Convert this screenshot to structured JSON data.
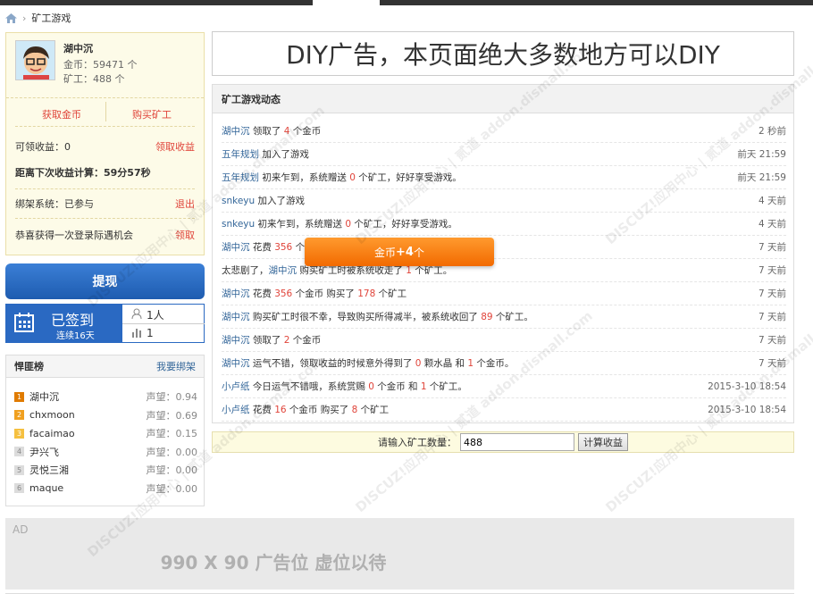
{
  "breadcrumb": {
    "current": "矿工游戏"
  },
  "user": {
    "name": "湖中沉",
    "gold": "金币：59471 个",
    "miners": "矿工：488 个",
    "get_gold": "获取金币",
    "buy_miner": "购买矿工",
    "claimable_label": "可领收益：0",
    "claim_btn": "领取收益",
    "countdown": "距离下次收益计算：59分57秒",
    "gang_label": "绑架系统：已参与",
    "gang_exit": "退出",
    "lottery_label": "恭喜获得一次登录际遇机会",
    "lottery_btn": "领取"
  },
  "withdraw": "提现",
  "signin": {
    "status": "已签到",
    "streak": "连续16天",
    "people": "1人",
    "rank": "1"
  },
  "ranking": {
    "title": "悍匪榜",
    "link": "我要绑架",
    "rows": [
      {
        "rank": "1",
        "name": "湖中沉",
        "rep": "声望：0.94",
        "color": "#e07b00"
      },
      {
        "rank": "2",
        "name": "chxmoon",
        "rep": "声望：0.69",
        "color": "#f0a020"
      },
      {
        "rank": "3",
        "name": "facaimao",
        "rep": "声望：0.15",
        "color": "#f5c040"
      },
      {
        "rank": "4",
        "name": "尹兴飞",
        "rep": "声望：0.00",
        "color": "#dcdcdc"
      },
      {
        "rank": "5",
        "name": "灵悦三湘",
        "rep": "声望：0.00",
        "color": "#dcdcdc"
      },
      {
        "rank": "6",
        "name": "maque",
        "rep": "声望：0.00",
        "color": "#dcdcdc"
      }
    ]
  },
  "diy": "DIY广告，本页面绝大多数地方可以DIY",
  "feed": {
    "title": "矿工游戏动态",
    "items": [
      {
        "who": "湖中沉",
        "a": " 领取了 ",
        "n1": "4",
        "b": " 个金币",
        "n2": "",
        "c": "",
        "n3": "",
        "d": "",
        "time": "2 秒前"
      },
      {
        "who": "五年规划",
        "a": " 加入了游戏",
        "n1": "",
        "b": "",
        "n2": "",
        "c": "",
        "n3": "",
        "d": "",
        "time": "前天 21:59"
      },
      {
        "who": "五年规划",
        "a": " 初来乍到，系统赠送 ",
        "n1": "0",
        "b": " 个矿工，好好享受游戏。",
        "n2": "",
        "c": "",
        "n3": "",
        "d": "",
        "time": "前天 21:59"
      },
      {
        "who": "snkeyu",
        "a": " 加入了游戏",
        "n1": "",
        "b": "",
        "n2": "",
        "c": "",
        "n3": "",
        "d": "",
        "time": "4 天前"
      },
      {
        "who": "snkeyu",
        "a": " 初来乍到，系统赠送 ",
        "n1": "0",
        "b": " 个矿工，好好享受游戏。",
        "n2": "",
        "c": "",
        "n3": "",
        "d": "",
        "time": "4 天前"
      },
      {
        "who": "湖中沉",
        "a": " 花费 ",
        "n1": "356",
        "b": " 个",
        "n2": "",
        "c": "",
        "n3": "",
        "d": "",
        "time": "7 天前"
      },
      {
        "who": "",
        "a": "太悲剧了，",
        "n1": "",
        "b": "",
        "n2": "",
        "c": "",
        "n3": "",
        "d": "",
        "who2": "湖中沉",
        "e": " 购买矿工时被系统收走了 ",
        "n4": "1",
        "f": " 个矿工。",
        "time": "7 天前"
      },
      {
        "who": "湖中沉",
        "a": " 花费 ",
        "n1": "356",
        "b": " 个金币 购买了 ",
        "n2": "178",
        "c": " 个矿工",
        "n3": "",
        "d": "",
        "time": "7 天前"
      },
      {
        "who": "湖中沉",
        "a": " 购买矿工时很不幸，导致购买所得减半，被系统收回了 ",
        "n1": "89",
        "b": " 个矿工。",
        "n2": "",
        "c": "",
        "n3": "",
        "d": "",
        "time": "7 天前"
      },
      {
        "who": "湖中沉",
        "a": " 领取了 ",
        "n1": "2",
        "b": " 个金币",
        "n2": "",
        "c": "",
        "n3": "",
        "d": "",
        "time": "7 天前"
      },
      {
        "who": "湖中沉",
        "a": " 运气不错，领取收益的时候意外得到了 ",
        "n1": "0",
        "b": " 颗水晶 和 ",
        "n2": "1",
        "c": " 个金币。",
        "n3": "",
        "d": "",
        "time": "7 天前"
      },
      {
        "who": "小卢纸",
        "a": " 今日运气不错哦，系统赏赐 ",
        "n1": "0",
        "b": " 个金币 和 ",
        "n2": "1",
        "c": " 个矿工。",
        "n3": "",
        "d": "",
        "time": "2015-3-10 18:54"
      },
      {
        "who": "小卢纸",
        "a": " 花费 ",
        "n1": "16",
        "b": " 个金币 购买了 ",
        "n2": "8",
        "c": " 个矿工",
        "n3": "",
        "d": "",
        "time": "2015-3-10 18:54"
      }
    ]
  },
  "toast": {
    "prefix": "金币",
    "value": "+4",
    "suffix": "个"
  },
  "calc": {
    "label": "请输入矿工数量：",
    "value": "488",
    "button": "计算收益"
  },
  "ad": {
    "label": "AD",
    "text": "990 X 90 广告位 虚位以待"
  },
  "watermark": "DISCUZ!应用中心 | 贰道 addon.dismall.com"
}
